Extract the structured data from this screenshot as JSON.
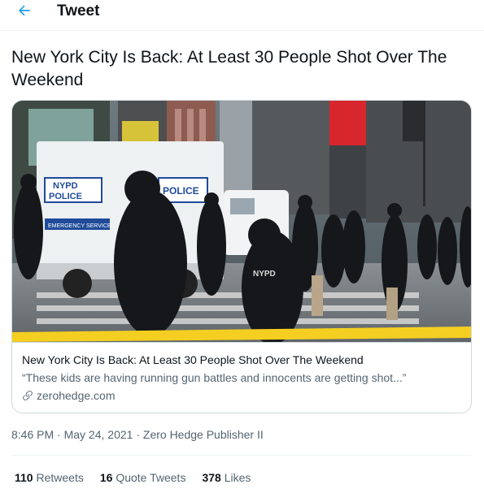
{
  "header": {
    "back_icon": "arrow-left-icon",
    "title": "Tweet"
  },
  "tweet": {
    "text": "New York City Is Back: At Least 30 People Shot Over The Weekend",
    "card": {
      "title": "New York City Is Back: At Least 30 People Shot Over The Weekend",
      "description": "“These kids are having running gun battles and innocents are getting shot...”",
      "domain": "zerohedge.com",
      "link_icon": "link-icon",
      "image_texts": {
        "police_1": "NYPD",
        "police_2": "POLICE",
        "truck_label": "POLICE",
        "emergency": "EMERGENCY SERVICE",
        "vest": "NYPD"
      }
    },
    "meta": {
      "time": "8:46 PM",
      "separator": " · ",
      "date": "May 24, 2021",
      "source": "Zero Hedge Publisher II"
    },
    "stats": {
      "retweets_count": "110",
      "retweets_label": "Retweets",
      "quotes_count": "16",
      "quotes_label": "Quote Tweets",
      "likes_count": "378",
      "likes_label": "Likes"
    }
  },
  "colors": {
    "accent": "#1d9bf0",
    "text": "#0f1419",
    "secondary": "#536471",
    "border": "#cfd9de"
  }
}
